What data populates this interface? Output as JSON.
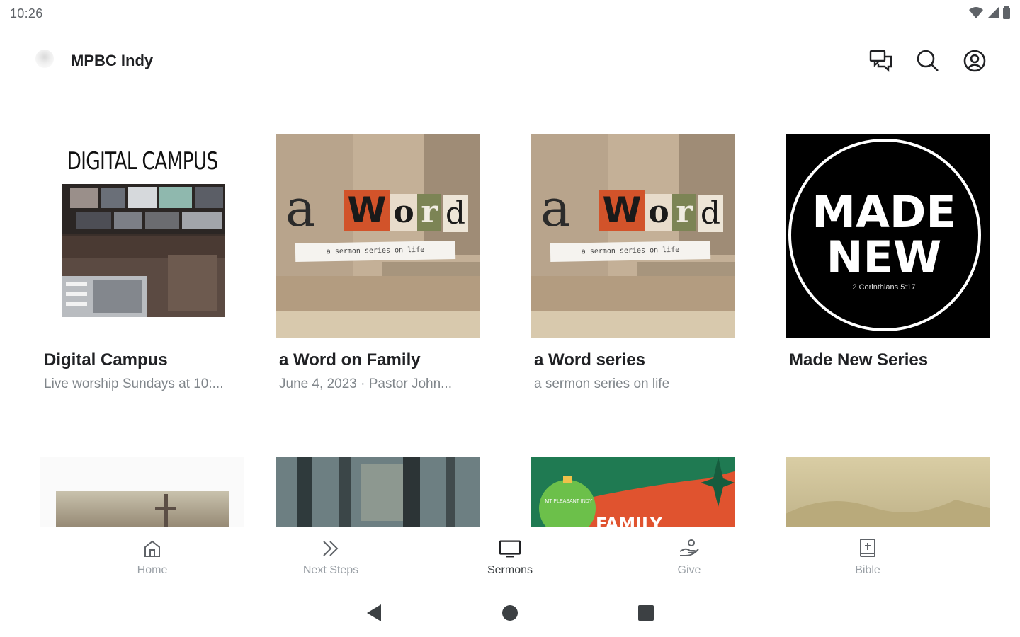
{
  "status": {
    "time": "10:26"
  },
  "app": {
    "title": "MPBC Indy"
  },
  "actions": {
    "messages_label": "messages-icon",
    "search_label": "search-icon",
    "account_label": "account-icon"
  },
  "row1": [
    {
      "title": "Digital Campus",
      "subtitle": "Live worship Sundays at 10:..."
    },
    {
      "title": "a Word on Family",
      "subtitle": "June 4, 2023 · Pastor John..."
    },
    {
      "title": "a Word series",
      "subtitle": "a sermon series on life"
    },
    {
      "title": "Made New Series",
      "subtitle": ""
    }
  ],
  "art": {
    "digital_campus": "DIGITAL CAMPUS",
    "word_a": "a",
    "word_letters": [
      "W",
      "o",
      "r",
      "d"
    ],
    "word_strip": "a sermon series on life",
    "made_new_1": "MADE",
    "made_new_2": "NEW",
    "made_new_ref": "2 Corinthians 5:17",
    "family_badge": "MT PLEASANT INDY",
    "family_word": "FAMILY"
  },
  "nav": [
    {
      "label": "Home",
      "icon": "home-icon"
    },
    {
      "label": "Next Steps",
      "icon": "double-chevron-icon"
    },
    {
      "label": "Sermons",
      "icon": "tv-icon",
      "active": true
    },
    {
      "label": "Give",
      "icon": "give-hand-icon"
    },
    {
      "label": "Bible",
      "icon": "bible-icon"
    }
  ],
  "colors": {
    "accent": "#202124",
    "muted": "#80868b",
    "inactive_nav": "#9aa0a6"
  }
}
